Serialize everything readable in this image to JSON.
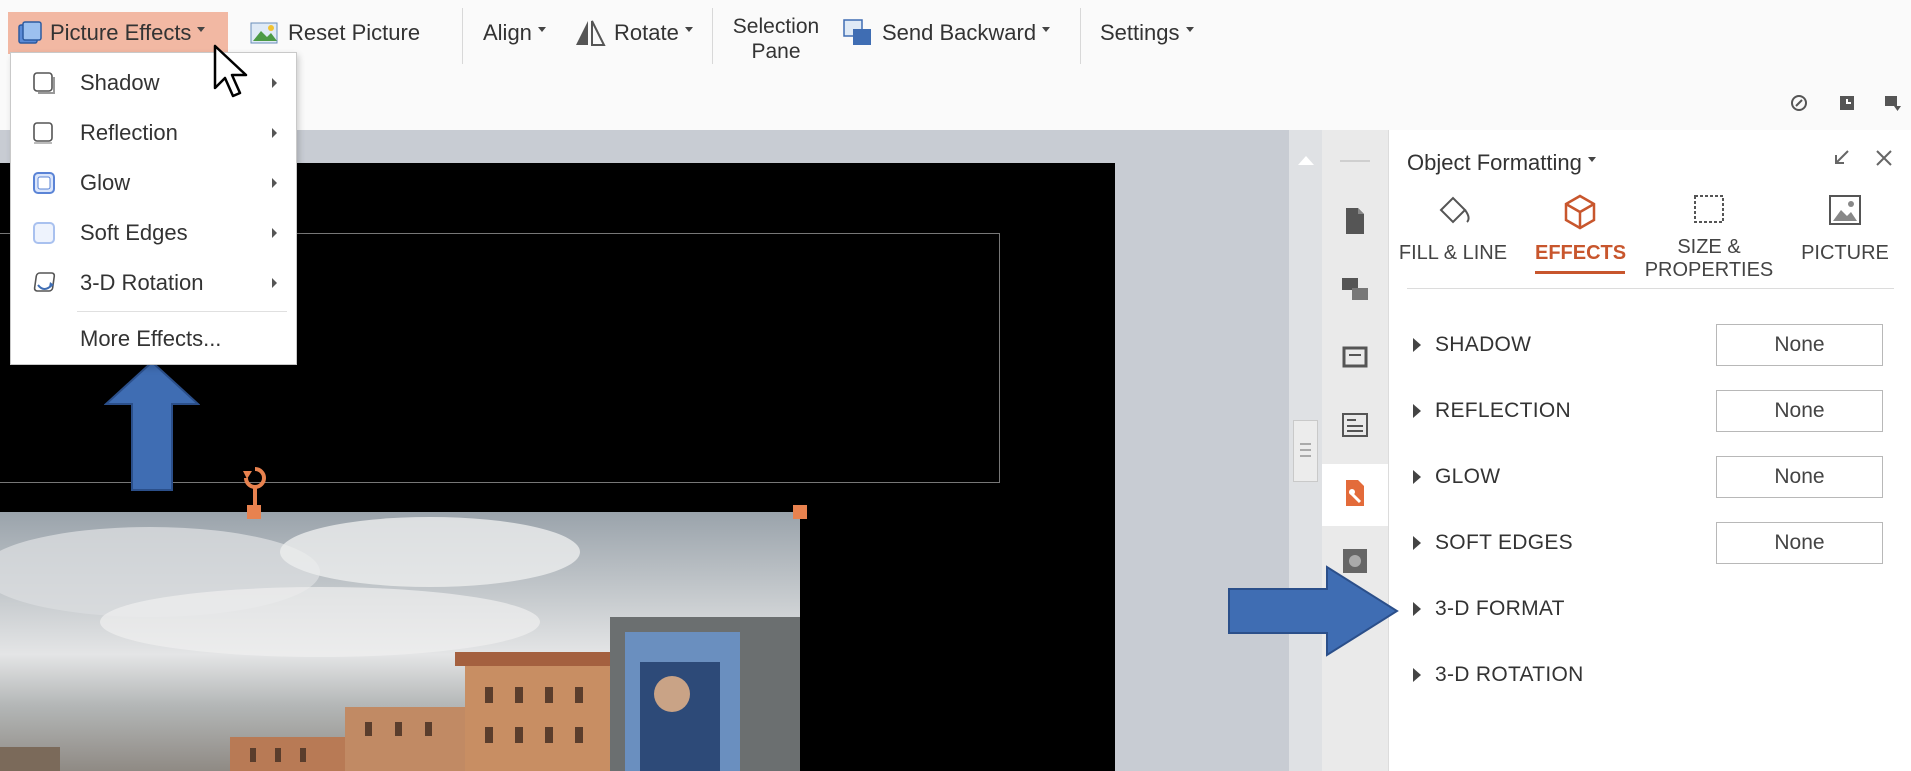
{
  "ribbon": {
    "picture_effects": "Picture Effects",
    "reset_picture": "Reset Picture",
    "align": "Align",
    "rotate": "Rotate",
    "selection_pane_line1": "Selection",
    "selection_pane_line2": "Pane",
    "send_backward": "Send Backward",
    "settings": "Settings"
  },
  "menu": {
    "items": [
      {
        "label": "Shadow",
        "icon": "shadow-icon"
      },
      {
        "label": "Reflection",
        "icon": "reflection-icon"
      },
      {
        "label": "Glow",
        "icon": "glow-icon"
      },
      {
        "label": "Soft Edges",
        "icon": "soft-edges-icon"
      },
      {
        "label": "3-D Rotation",
        "icon": "3d-rotation-icon"
      }
    ],
    "more": "More Effects..."
  },
  "pane": {
    "title": "Object Formatting",
    "tabs": [
      {
        "label_line1": "FILL & LINE",
        "label_line2": ""
      },
      {
        "label_line1": "EFFECTS",
        "label_line2": ""
      },
      {
        "label_line1": "SIZE &",
        "label_line2": "PROPERTIES"
      },
      {
        "label_line1": "PICTURE",
        "label_line2": ""
      }
    ],
    "sections": [
      {
        "label": "SHADOW",
        "value": "None"
      },
      {
        "label": "REFLECTION",
        "value": "None"
      },
      {
        "label": "GLOW",
        "value": "None"
      },
      {
        "label": "SOFT EDGES",
        "value": "None"
      },
      {
        "label": "3-D FORMAT",
        "value": ""
      },
      {
        "label": "3-D ROTATION",
        "value": ""
      }
    ]
  },
  "colors": {
    "accent": "#c8562d",
    "highlight": "#f2b8a3",
    "arrow": "#3f6db3"
  }
}
